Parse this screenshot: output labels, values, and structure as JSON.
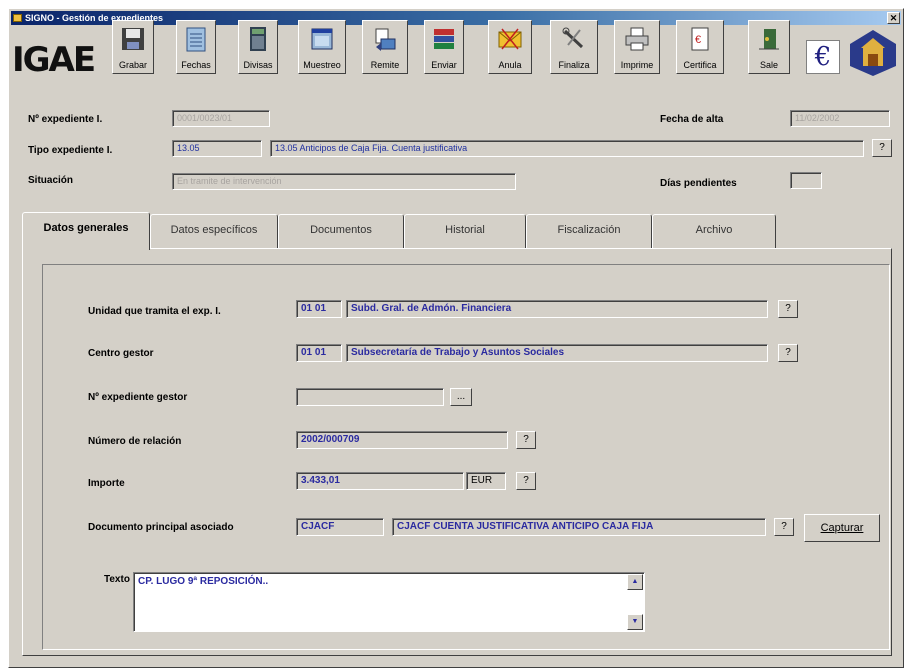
{
  "window": {
    "title": "SIGNO - Gestión de expedientes",
    "close_glyph": "✕"
  },
  "logo": {
    "text": "IGAE"
  },
  "toolbar": [
    {
      "id": "grabar",
      "label": "Grabar",
      "icon": "floppy-icon"
    },
    {
      "id": "fechas",
      "label": "Fechas",
      "icon": "calendar-icon"
    },
    {
      "id": "divisas",
      "label": "Divisas",
      "icon": "calculator-icon"
    },
    {
      "id": "muestreo",
      "label": "Muestreo",
      "icon": "window-icon"
    },
    {
      "id": "remite",
      "label": "Remite",
      "icon": "remit-icon"
    },
    {
      "id": "enviar",
      "label": "Enviar",
      "icon": "books-icon"
    },
    {
      "id": "anula",
      "label": "Anula",
      "icon": "envelope-icon"
    },
    {
      "id": "finaliza",
      "label": "Finaliza",
      "icon": "tools-icon"
    },
    {
      "id": "imprime",
      "label": "Imprime",
      "icon": "printer-icon"
    },
    {
      "id": "certifica",
      "label": "Certifica",
      "icon": "certificate-icon"
    },
    {
      "id": "sale",
      "label": "Sale",
      "icon": "exit-icon"
    }
  ],
  "euro_glyph": "€",
  "header": {
    "expediente_label": "Nº expediente I.",
    "expediente_value": "0001/0023/01",
    "fecha_alta_label": "Fecha de alta",
    "fecha_alta_value": "11/02/2002",
    "tipo_label": "Tipo expediente I.",
    "tipo_code": "13.05",
    "tipo_desc": "13.05 Anticipos de Caja Fija. Cuenta justificativa",
    "situacion_label": "Situación",
    "situacion_value": "En tramite de intervención",
    "dias_label": "Días pendientes",
    "dias_value": "",
    "q": "?"
  },
  "tabs": [
    {
      "label": "Datos generales",
      "active": true
    },
    {
      "label": "Datos específicos",
      "active": false
    },
    {
      "label": "Documentos",
      "active": false
    },
    {
      "label": "Historial",
      "active": false
    },
    {
      "label": "Fiscalización",
      "active": false
    },
    {
      "label": "Archivo",
      "active": false
    }
  ],
  "form": {
    "unidad_label": "Unidad que tramita el exp. I.",
    "unidad_code": "01 01",
    "unidad_desc": "Subd. Gral. de Admón. Financiera",
    "centro_label": "Centro gestor",
    "centro_code": "01 01",
    "centro_desc": "Subsecretaría de Trabajo y Asuntos Sociales",
    "exp_gestor_label": "Nº expediente gestor",
    "exp_gestor_value": "",
    "relacion_label": "Número de relación",
    "relacion_value": "2002/000709",
    "importe_label": "Importe",
    "importe_value": "3.433,01",
    "importe_currency": "EUR",
    "doc_label": "Documento principal asociado",
    "doc_code": "CJACF",
    "doc_desc": "CJACF  CUENTA JUSTIFICATIVA ANTICIPO CAJA FIJA",
    "capturar_label": "Capturar",
    "texto_label": "Texto",
    "texto_value": "CP. LUGO 9ª REPOSICIÓN..",
    "q": "?",
    "ellipsis": "..."
  }
}
